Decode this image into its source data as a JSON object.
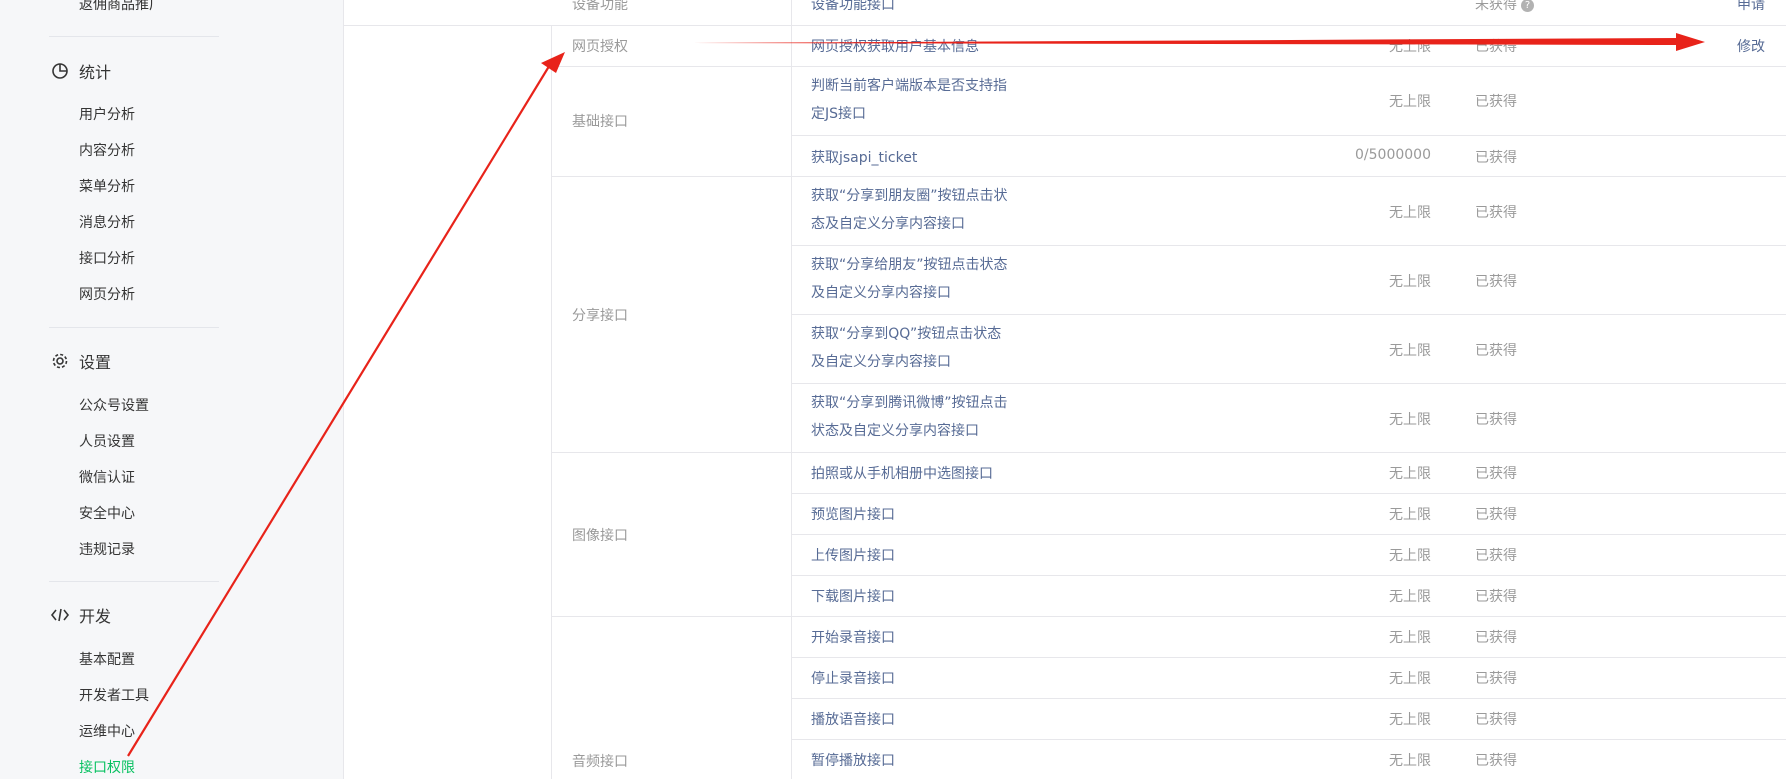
{
  "sidebar": {
    "top_item": "返佣商品推广",
    "stats": {
      "title": "统计",
      "icon": "pie-chart-icon",
      "items": [
        "用户分析",
        "内容分析",
        "菜单分析",
        "消息分析",
        "接口分析",
        "网页分析"
      ]
    },
    "settings": {
      "title": "设置",
      "icon": "gear-icon",
      "items": [
        "公众号设置",
        "人员设置",
        "微信认证",
        "安全中心",
        "违规记录"
      ]
    },
    "dev": {
      "title": "开发",
      "icon": "code-icon",
      "items": [
        "基本配置",
        "开发者工具",
        "运维中心",
        "接口权限"
      ],
      "active_item": "接口权限"
    }
  },
  "table": {
    "rows": {
      "device": {
        "category": "设备功能",
        "name": "设备功能接口",
        "status": "未获得",
        "action": "申请"
      },
      "webauth": {
        "category": "网页授权",
        "name": "网页授权获取用户基本信息",
        "limit": "无上限",
        "status": "已获得",
        "action": "修改"
      },
      "basic": {
        "category": "基础接口",
        "r1": {
          "name": "判断当前客户端版本是否支持指定JS接口",
          "limit": "无上限",
          "status": "已获得"
        },
        "r2": {
          "name": "获取jsapi_ticket",
          "limit": "0/5000000",
          "status": "已获得"
        }
      },
      "share": {
        "category": "分享接口",
        "r1": {
          "name": "获取“分享到朋友圈”按钮点击状态及自定义分享内容接口",
          "limit": "无上限",
          "status": "已获得"
        },
        "r2": {
          "name": "获取“分享给朋友”按钮点击状态及自定义分享内容接口",
          "limit": "无上限",
          "status": "已获得"
        },
        "r3": {
          "name": "获取“分享到QQ”按钮点击状态及自定义分享内容接口",
          "limit": "无上限",
          "status": "已获得"
        },
        "r4": {
          "name": "获取“分享到腾讯微博”按钮点击状态及自定义分享内容接口",
          "limit": "无上限",
          "status": "已获得"
        }
      },
      "image": {
        "category": "图像接口",
        "r1": {
          "name": "拍照或从手机相册中选图接口",
          "limit": "无上限",
          "status": "已获得"
        },
        "r2": {
          "name": "预览图片接口",
          "limit": "无上限",
          "status": "已获得"
        },
        "r3": {
          "name": "上传图片接口",
          "limit": "无上限",
          "status": "已获得"
        },
        "r4": {
          "name": "下载图片接口",
          "limit": "无上限",
          "status": "已获得"
        }
      },
      "audio": {
        "category": "音频接口",
        "r1": {
          "name": "开始录音接口",
          "limit": "无上限",
          "status": "已获得"
        },
        "r2": {
          "name": "停止录音接口",
          "limit": "无上限",
          "status": "已获得"
        },
        "r3": {
          "name": "播放语音接口",
          "limit": "无上限",
          "status": "已获得"
        },
        "r4": {
          "name": "暂停播放接口",
          "limit": "无上限",
          "status": "已获得"
        }
      }
    }
  },
  "colors": {
    "accent": "#07c160",
    "link": "#576b95",
    "muted": "#9a9a9a",
    "annotation": "#e8231a"
  }
}
